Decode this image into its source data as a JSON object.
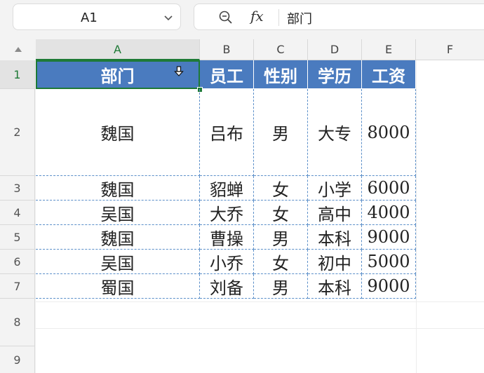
{
  "name_box": {
    "value": "A1"
  },
  "formula_bar": {
    "fx_label": "fx",
    "value": "部门"
  },
  "columns": [
    "A",
    "B",
    "C",
    "D",
    "E",
    "F"
  ],
  "rows": [
    "1",
    "2",
    "3",
    "4",
    "5",
    "6",
    "7",
    "8",
    "9"
  ],
  "table": {
    "headers": [
      "部门",
      "员工",
      "性别",
      "学历",
      "工资"
    ],
    "body": [
      [
        "魏国",
        "吕布",
        "男",
        "大专",
        "8000"
      ],
      [
        "魏国",
        "貂蝉",
        "女",
        "小学",
        "6000"
      ],
      [
        "吴国",
        "大乔",
        "女",
        "高中",
        "4000"
      ],
      [
        "魏国",
        "曹操",
        "男",
        "本科",
        "9000"
      ],
      [
        "吴国",
        "小乔",
        "女",
        "初中",
        "5000"
      ],
      [
        "蜀国",
        "刘备",
        "男",
        "本科",
        "9000"
      ]
    ]
  },
  "colors": {
    "header_fill": "#4a7bbf",
    "selection": "#1e7a36",
    "border": "#5b8fc9"
  },
  "icons": {
    "zoom": "zoom-out-icon",
    "filter": "filter-dropdown-icon",
    "chevron": "chevron-down-icon"
  }
}
